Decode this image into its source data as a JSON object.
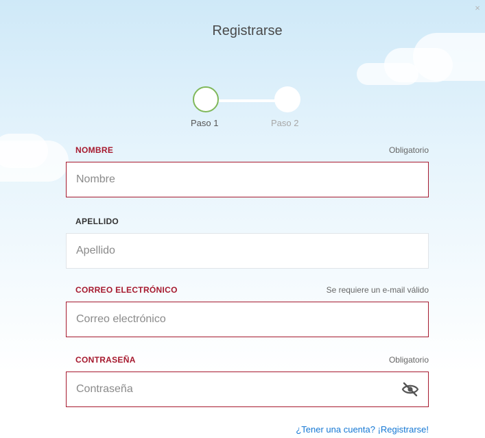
{
  "dialog": {
    "title": "Registrarse",
    "close_icon": "close-icon",
    "close_label": "×"
  },
  "stepper": {
    "steps": [
      {
        "label": "Paso 1",
        "state": "active"
      },
      {
        "label": "Paso 2",
        "state": "pending"
      }
    ]
  },
  "fields": {
    "nombre": {
      "label": "NOMBRE",
      "hint": "Obligatorio",
      "placeholder": "Nombre",
      "value": "",
      "error": true
    },
    "apellido": {
      "label": "APELLIDO",
      "hint": "",
      "placeholder": "Apellido",
      "value": "",
      "error": false
    },
    "correo": {
      "label": "CORREO ELECTRÓNICO",
      "hint": "Se requiere un e-mail válido",
      "placeholder": "Correo electrónico",
      "value": "",
      "error": true
    },
    "contrasena": {
      "label": "CONTRASEÑA",
      "hint": "Obligatorio",
      "placeholder": "Contraseña",
      "value": "",
      "error": true,
      "toggle_icon": "eye-slash-icon"
    }
  },
  "footer": {
    "link_text": "¿Tener una cuenta? ¡Registrarse!"
  },
  "colors": {
    "error": "#a6192e",
    "link": "#1477d4",
    "step_active": "#80b85a"
  }
}
